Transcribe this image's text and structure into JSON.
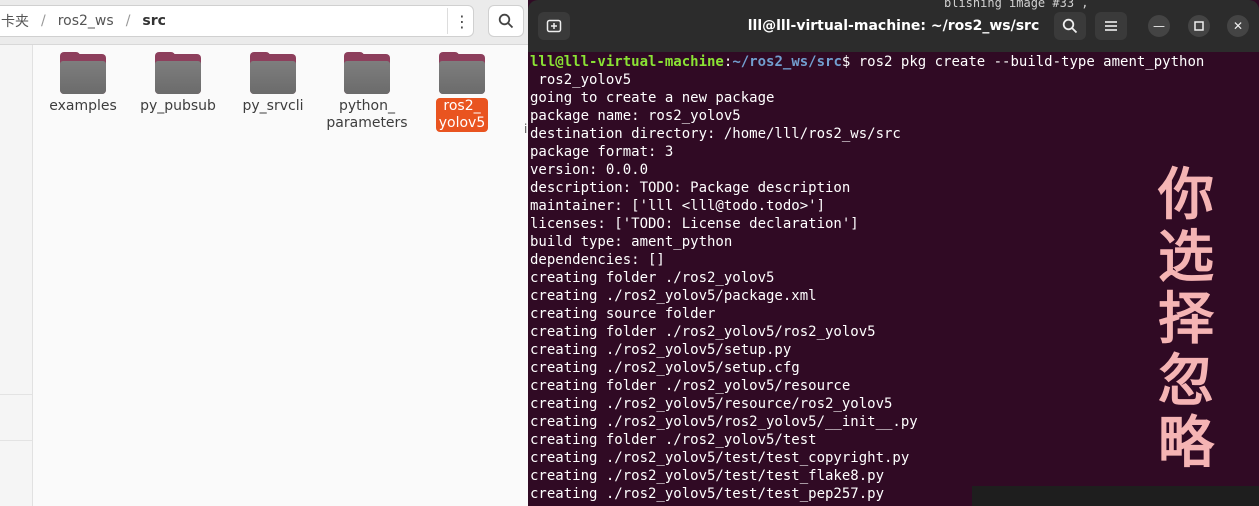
{
  "file_manager": {
    "breadcrumb": [
      "ros2_ws",
      "src"
    ],
    "breadcrumb_partial": "卡夹",
    "items": [
      {
        "name": "examples",
        "selected": false
      },
      {
        "name": "py_pubsub",
        "selected": false
      },
      {
        "name": "py_srvcli",
        "selected": false
      },
      {
        "name": "python_\nparameters",
        "selected": false
      },
      {
        "name": "ros2_\nyolov5",
        "selected": true
      }
    ],
    "cut_text": "i"
  },
  "terminal": {
    "title": "lll@lll-virtual-machine: ~/ros2_ws/src",
    "prompt_user": "lll@lll-virtual-machine",
    "prompt_path": "~/ros2_ws/src",
    "command": "$ ros2 pkg create --build-type ament_python",
    "lines": [
      " ros2_yolov5",
      "going to create a new package",
      "package name: ros2_yolov5",
      "destination directory: /home/lll/ros2_ws/src",
      "package format: 3",
      "version: 0.0.0",
      "description: TODO: Package description",
      "maintainer: ['lll <lll@todo.todo>']",
      "licenses: ['TODO: License declaration']",
      "build type: ament_python",
      "dependencies: []",
      "creating folder ./ros2_yolov5",
      "creating ./ros2_yolov5/package.xml",
      "creating source folder",
      "creating folder ./ros2_yolov5/ros2_yolov5",
      "creating ./ros2_yolov5/setup.py",
      "creating ./ros2_yolov5/setup.cfg",
      "creating folder ./ros2_yolov5/resource",
      "creating ./ros2_yolov5/resource/ros2_yolov5",
      "creating ./ros2_yolov5/ros2_yolov5/__init__.py",
      "creating folder ./ros2_yolov5/test",
      "creating ./ros2_yolov5/test/test_copyright.py",
      "creating ./ros2_yolov5/test/test_flake8.py",
      "creating ./ros2_yolov5/test/test_pep257.py"
    ],
    "overlay_text": "你选择忽略",
    "background_hint": "blishing image #33 ,"
  },
  "colors": {
    "terminal_bg": "#300a24",
    "prompt_user": "#8ae234",
    "prompt_path": "#729fcf",
    "selection": "#e95420",
    "overlay": "#f5b4b4"
  }
}
